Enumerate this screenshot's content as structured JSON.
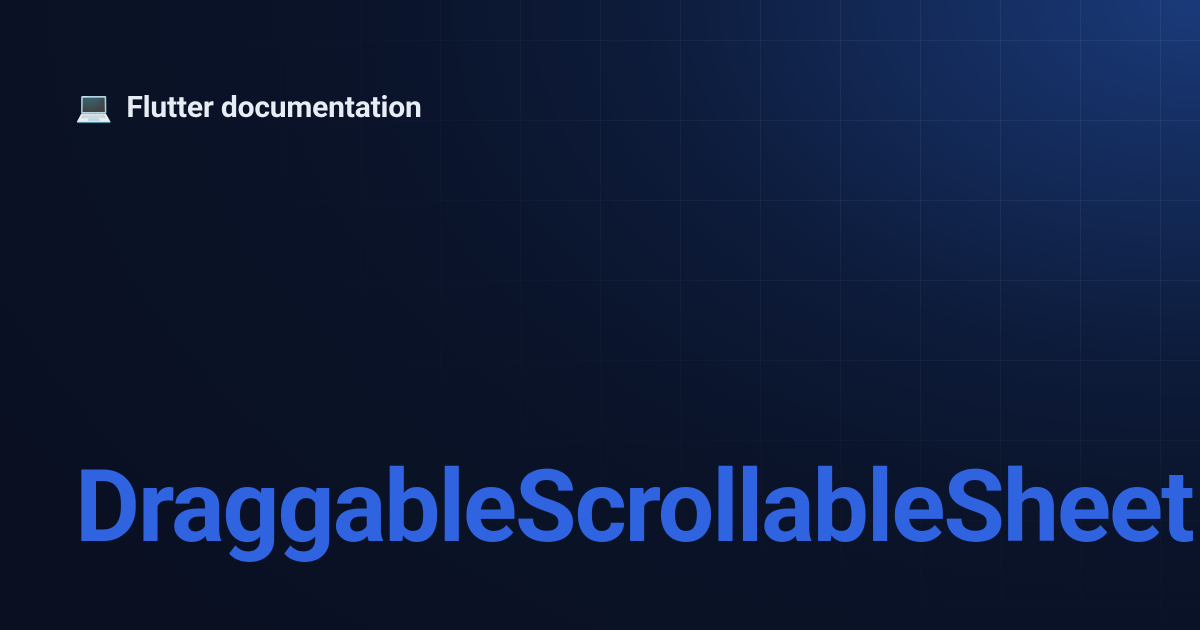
{
  "header": {
    "icon": "💻",
    "title": "Flutter documentation"
  },
  "page": {
    "title": "DraggableScrollableSheet"
  }
}
